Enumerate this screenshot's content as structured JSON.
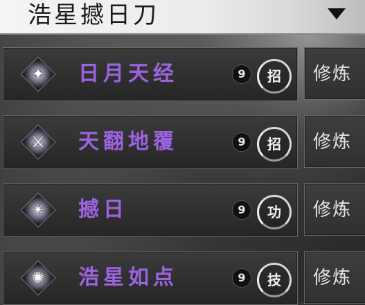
{
  "header": {
    "title": "浩星撼日刀"
  },
  "skills": [
    {
      "name": "日月天经",
      "ear_glyph": "9",
      "type": "招",
      "action": "修炼",
      "icon": "sun-moon-icon"
    },
    {
      "name": "天翻地覆",
      "ear_glyph": "9",
      "type": "招",
      "action": "修炼",
      "icon": "blade-storm-icon"
    },
    {
      "name": "撼日",
      "ear_glyph": "9",
      "type": "功",
      "action": "修炼",
      "icon": "shatter-sun-icon"
    },
    {
      "name": "浩星如点",
      "ear_glyph": "9",
      "type": "技",
      "action": "修炼",
      "icon": "star-swirl-icon"
    }
  ],
  "colors": {
    "skill_name": "#9d63e2",
    "header_bg": "#f4f4f2"
  }
}
